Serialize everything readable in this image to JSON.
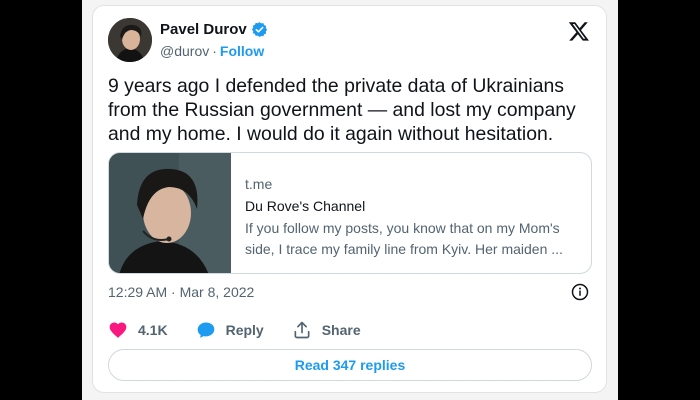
{
  "author": {
    "name": "Pavel Durov",
    "handle": "@durov",
    "separator": "·",
    "follow_label": "Follow"
  },
  "tweet": {
    "text": "9 years ago I defended the private data of Ukrainians from the Russian government — and lost my company and my home. I would do it again without hesitation.",
    "timestamp": "12:29 AM · Mar 8, 2022"
  },
  "link_card": {
    "domain": "t.me",
    "title": "Du Rove's Channel",
    "description": "If you follow my posts, you know that on my Mom's side, I trace my family line from Kyiv. Her maiden ..."
  },
  "actions": {
    "likes": "4.1K",
    "reply_label": "Reply",
    "share_label": "Share"
  },
  "read_replies_label": "Read 347 replies",
  "colors": {
    "accent": "#1d9bf0",
    "like": "#f91880",
    "text_primary": "#0f1419",
    "text_secondary": "#536471"
  }
}
